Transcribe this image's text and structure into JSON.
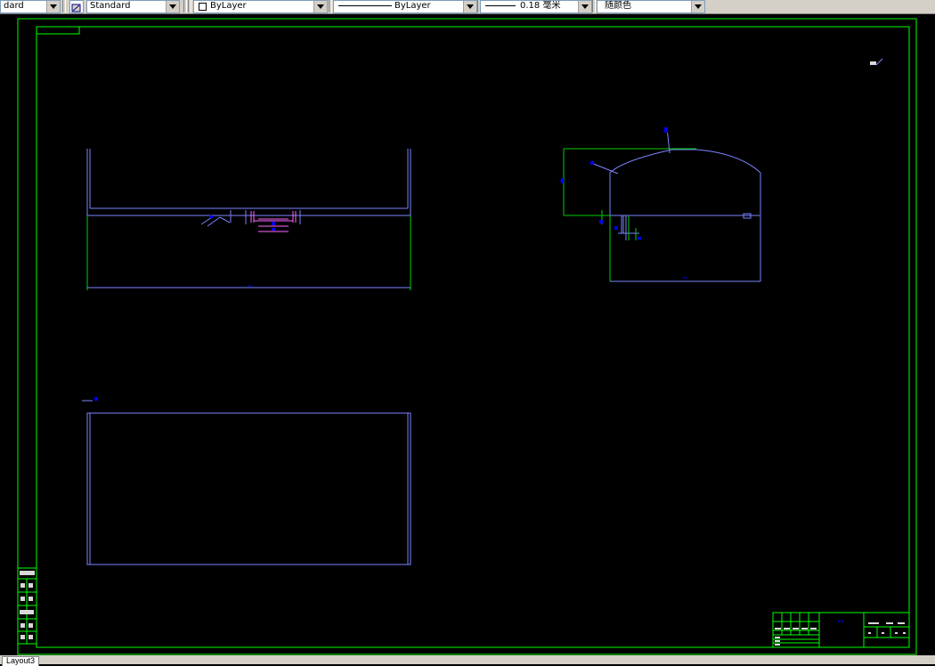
{
  "toolbar": {
    "textstyle_value": "dard",
    "dimstyle_value": "Standard",
    "layer_value": "ByLayer",
    "linetype_value": "ByLayer",
    "lineweight_value": "0.18 毫米",
    "color_value": "随颜色"
  },
  "tabs": {
    "active": "Layout3"
  },
  "colors": {
    "background": "#000000",
    "border": "#00ff00",
    "geometry": "#7b83ff",
    "dimension": "#00d000",
    "annotation": "#0000ff",
    "magenta": "#ff66ff"
  },
  "drawing": {
    "left_dim": "**",
    "right_dim": "**",
    "right_height_dim": "**",
    "corner_label": "**",
    "title_block_center": "**"
  }
}
